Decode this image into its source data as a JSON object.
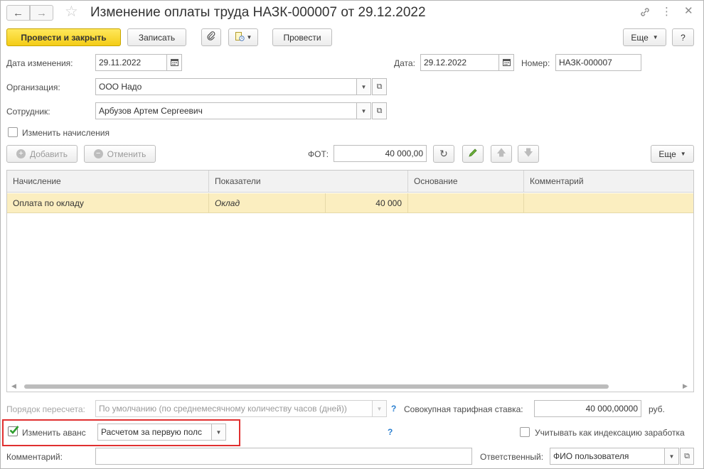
{
  "window": {
    "title": "Изменение оплаты труда НАЗК-000007 от 29.12.2022"
  },
  "toolbar": {
    "post_close": "Провести и закрыть",
    "save": "Записать",
    "post": "Провести",
    "more": "Еще",
    "help": "?"
  },
  "header": {
    "change_date_label": "Дата изменения:",
    "change_date": "29.11.2022",
    "date_label": "Дата:",
    "date": "29.12.2022",
    "number_label": "Номер:",
    "number": "НАЗК-000007",
    "org_label": "Организация:",
    "org": "ООО Надо",
    "employee_label": "Сотрудник:",
    "employee": "Арбузов Артем Сергеевич",
    "change_accruals_label": "Изменить начисления"
  },
  "grid_toolbar": {
    "add": "Добавить",
    "cancel": "Отменить",
    "fot_label": "ФОТ:",
    "fot": "40 000,00",
    "more": "Еще"
  },
  "table": {
    "columns": [
      "Начисление",
      "Показатели",
      "Основание",
      "Комментарий"
    ],
    "rows": [
      {
        "accrual": "Оплата по окладу",
        "indicator": "Оклад",
        "value": "40 000",
        "basis": "",
        "comment": ""
      }
    ]
  },
  "footer": {
    "recalc_label": "Порядок пересчета:",
    "recalc": "По умолчанию (по среднемесячному количеству часов (дней))",
    "rate_label": "Совокупная тарифная ставка:",
    "rate": "40 000,00000",
    "rate_unit": "руб.",
    "advance_label": "Изменить аванс",
    "advance_checked": true,
    "advance_method": "Расчетом за первую полс",
    "indexation_label": "Учитывать как индексацию заработка",
    "comment_label": "Комментарий:",
    "comment": "",
    "responsible_label": "Ответственный:",
    "responsible": "ФИО пользователя",
    "help_mark": "?"
  },
  "colors": {
    "primary_button": "#f4cc16",
    "selected_row": "#fbeec0",
    "highlight_box": "#e03030",
    "help": "#2a7fd0",
    "check": "#2e9e2e"
  }
}
